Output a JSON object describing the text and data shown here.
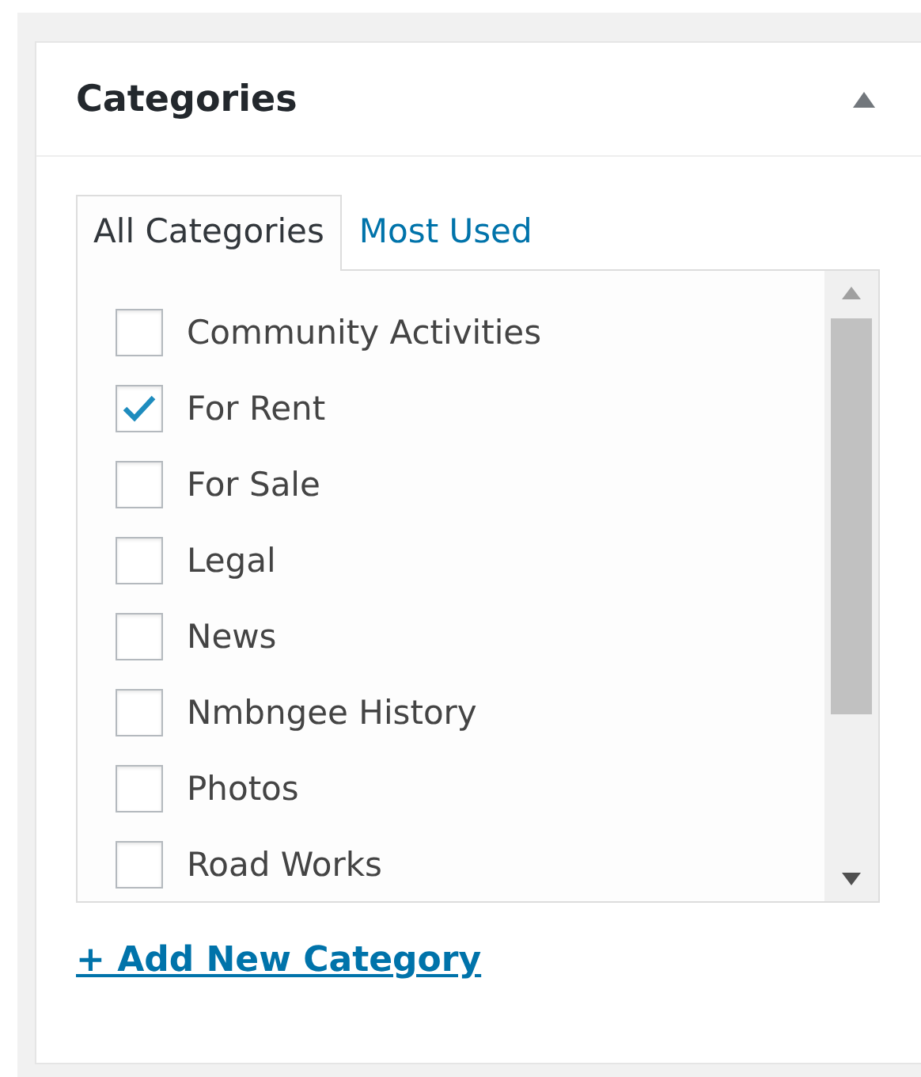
{
  "panel": {
    "title": "Categories",
    "collapsed": false
  },
  "tabs": [
    {
      "label": "All Categories",
      "selected": true
    },
    {
      "label": "Most Used",
      "selected": false
    }
  ],
  "categories": [
    {
      "label": "Community Activities",
      "checked": false
    },
    {
      "label": "For Rent",
      "checked": true
    },
    {
      "label": "For Sale",
      "checked": false
    },
    {
      "label": "Legal",
      "checked": false
    },
    {
      "label": "News",
      "checked": false
    },
    {
      "label": "Nmbngee History",
      "checked": false
    },
    {
      "label": "Photos",
      "checked": false
    },
    {
      "label": "Road Works",
      "checked": false
    }
  ],
  "add_link": "+ Add New Category"
}
